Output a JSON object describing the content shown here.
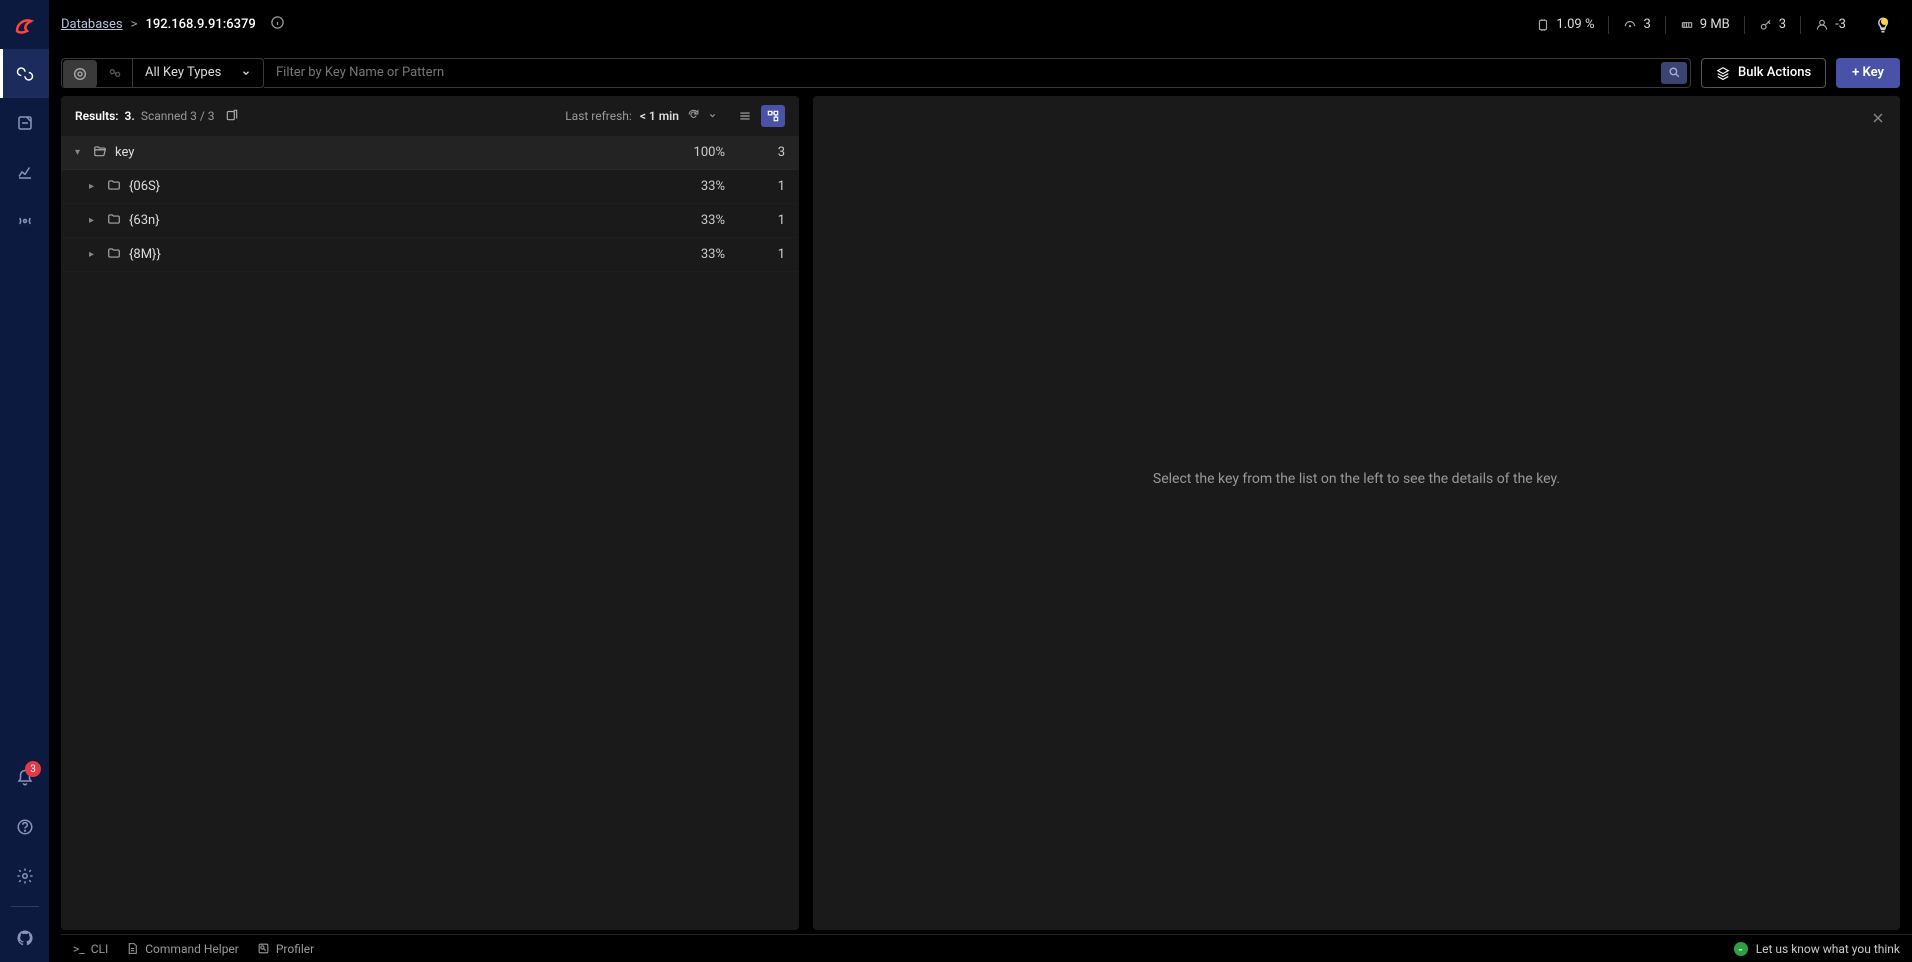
{
  "breadcrumb": {
    "root": "Databases",
    "sep": ">",
    "current": "192.168.9.91:6379"
  },
  "stats": {
    "cpu": "1.09 %",
    "commands": "3",
    "memory": "9 MB",
    "keys": "3",
    "clients": "-3"
  },
  "toolbar": {
    "key_type_label": "All Key Types",
    "search_placeholder": "Filter by Key Name or Pattern",
    "bulk_label": "Bulk Actions",
    "add_key_label": "+ Key"
  },
  "list": {
    "results_label": "Results:",
    "results_count": "3.",
    "scanned_label": "Scanned 3 / 3",
    "refresh_label": "Last refresh:",
    "refresh_value": "< 1 min"
  },
  "tree": {
    "root": {
      "name": "key",
      "pct": "100%",
      "cnt": "3"
    },
    "children": [
      {
        "name": "{06S}",
        "pct": "33%",
        "cnt": "1"
      },
      {
        "name": "{63n}",
        "pct": "33%",
        "cnt": "1"
      },
      {
        "name": "{8M}}",
        "pct": "33%",
        "cnt": "1"
      }
    ]
  },
  "detail": {
    "empty_message": "Select the key from the list on the left to see the details of the key."
  },
  "bottom": {
    "cli": "CLI",
    "helper": "Command Helper",
    "profiler": "Profiler",
    "feedback": "Let us know what you think"
  },
  "sidebar": {
    "notif_count": "3"
  }
}
